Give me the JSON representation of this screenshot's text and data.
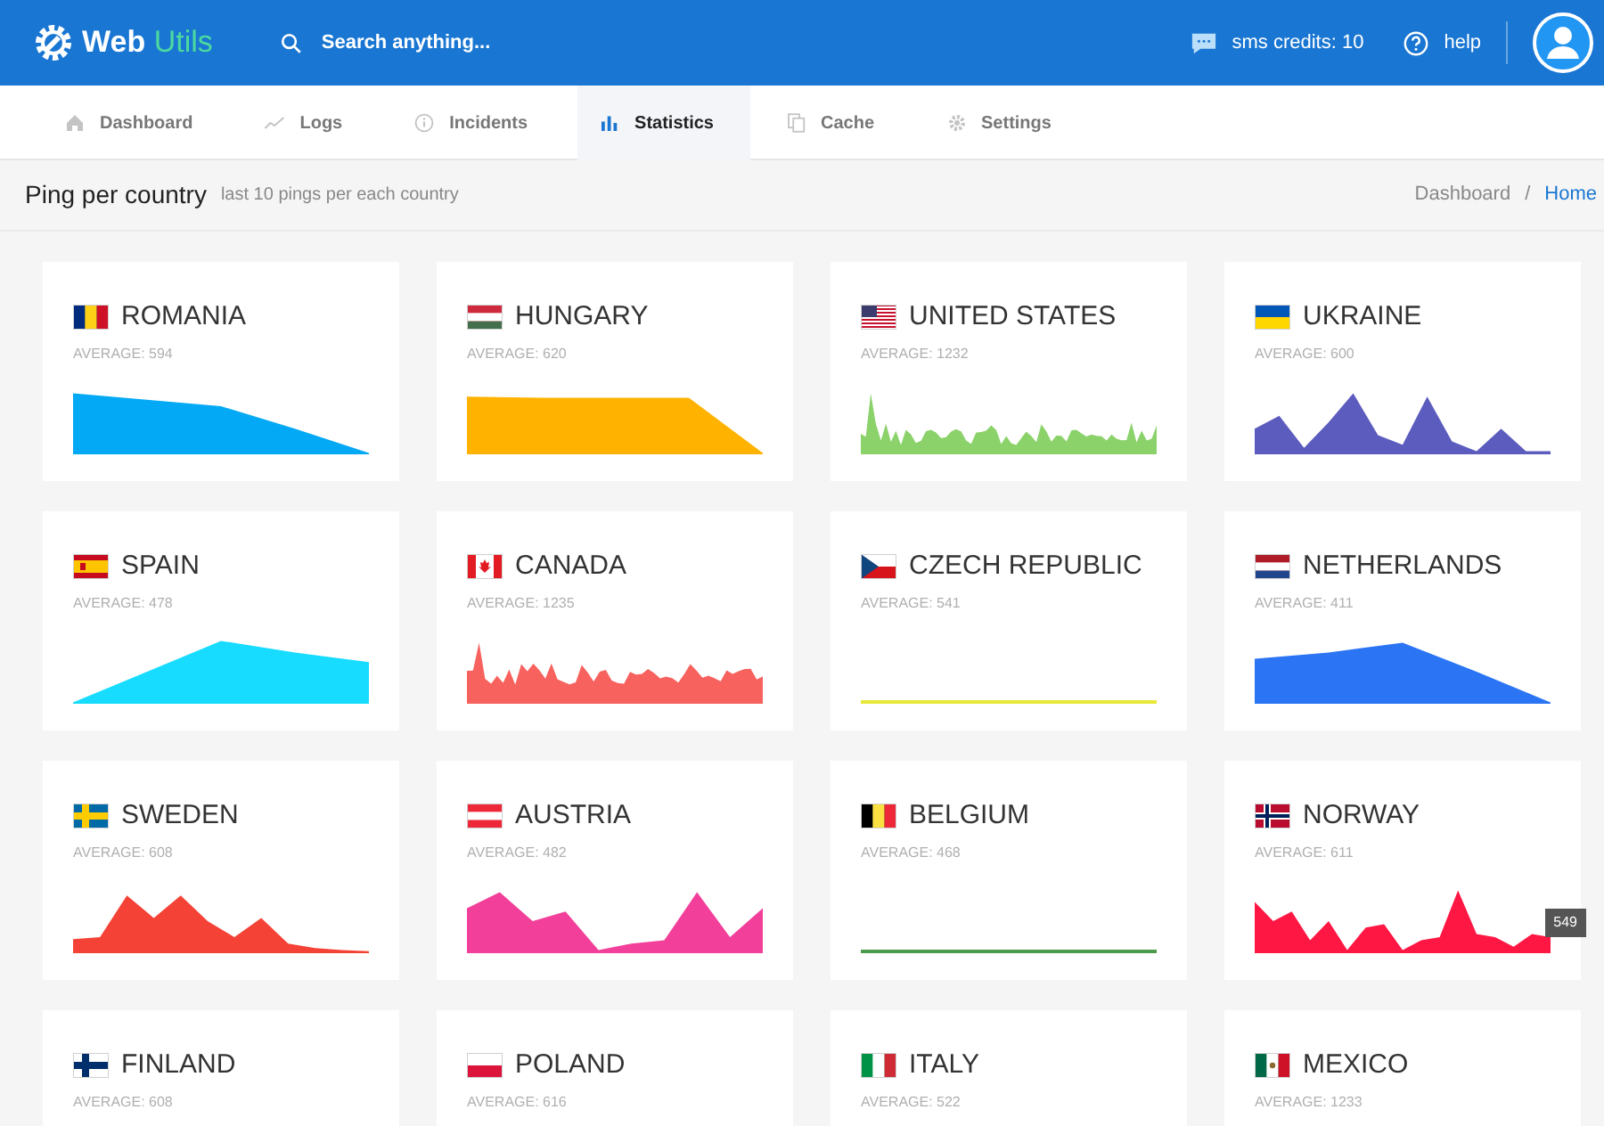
{
  "header": {
    "logo": {
      "text": "Web",
      "accent": "Utils"
    },
    "search": {
      "placeholder": "Search anything..."
    },
    "sms_credits": "sms credits: 10",
    "help": "help"
  },
  "nav": [
    {
      "label": "Dashboard",
      "selected": false
    },
    {
      "label": "Logs",
      "selected": false
    },
    {
      "label": "Incidents",
      "selected": false
    },
    {
      "label": "Statistics",
      "selected": true
    },
    {
      "label": "Cache",
      "selected": false
    },
    {
      "label": "Settings",
      "selected": false
    }
  ],
  "page": {
    "title": "Ping per country",
    "subtitle": "last 10 pings per each country",
    "breadcrumb_separator": "/",
    "breadcrumb": [
      {
        "label": "Dashboard",
        "selected": false
      },
      {
        "label": "Home",
        "selected": true
      }
    ]
  },
  "countries": [
    {
      "name": "ROMANIA",
      "average": "AVERAGE: 594",
      "sparkline": {
        "kind": "area",
        "color": "#03a9f4"
      }
    },
    {
      "name": "HUNGARY",
      "average": "AVERAGE: 620",
      "sparkline": {
        "kind": "area",
        "color": "#ffb300"
      }
    },
    {
      "name": "UNITED STATES",
      "average": "AVERAGE: 1232",
      "sparkline": {
        "kind": "area",
        "color": "#8bd26b"
      }
    },
    {
      "name": "UKRAINE",
      "average": "AVERAGE: 600",
      "sparkline": {
        "kind": "area",
        "color": "#5c5cbf"
      }
    },
    {
      "name": "SPAIN",
      "average": "AVERAGE: 478",
      "sparkline": {
        "kind": "area",
        "color": "#18dcff"
      }
    },
    {
      "name": "CANADA",
      "average": "AVERAGE: 1235",
      "sparkline": {
        "kind": "area",
        "color": "#f7625e"
      }
    },
    {
      "name": "CZECH REPUBLIC",
      "average": "AVERAGE: 541",
      "sparkline": {
        "kind": "line",
        "color": "#e8e83a"
      }
    },
    {
      "name": "NETHERLANDS",
      "average": "AVERAGE: 411",
      "sparkline": {
        "kind": "area",
        "color": "#2b75f5"
      }
    },
    {
      "name": "SWEDEN",
      "average": "AVERAGE: 608",
      "sparkline": {
        "kind": "area",
        "color": "#f44336"
      }
    },
    {
      "name": "AUSTRIA",
      "average": "AVERAGE: 482",
      "sparkline": {
        "kind": "area",
        "color": "#f2409a"
      }
    },
    {
      "name": "BELGIUM",
      "average": "AVERAGE: 468",
      "sparkline": {
        "kind": "line",
        "color": "#4c9b4c"
      }
    },
    {
      "name": "NORWAY",
      "average": "AVERAGE: 611",
      "sparkline": {
        "kind": "area",
        "color": "#ff1744"
      },
      "tooltip": "549"
    },
    {
      "name": "FINLAND",
      "average": "AVERAGE: 608"
    },
    {
      "name": "POLAND",
      "average": "AVERAGE: 616"
    },
    {
      "name": "ITALY",
      "average": "AVERAGE: 522"
    },
    {
      "name": "MEXICO",
      "average": "AVERAGE: 1233"
    }
  ]
}
